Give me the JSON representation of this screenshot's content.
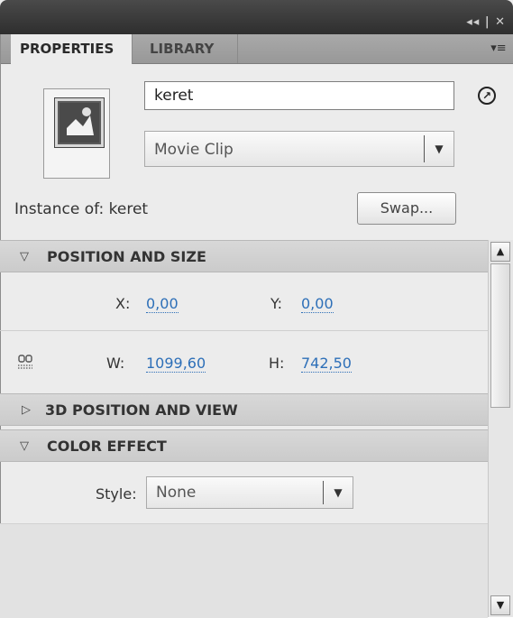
{
  "tabs": {
    "properties": "PROPERTIES",
    "library": "LIBRARY"
  },
  "window_controls": "◂◂ | ✕",
  "panel_menu_icon": "▾≡",
  "symbol": {
    "instance_name": "keret",
    "type": "Movie Clip",
    "instance_of_label": "Instance of:",
    "instance_of_value": "keret",
    "swap_label": "Swap..."
  },
  "sections": {
    "position_size": {
      "title": "POSITION AND SIZE",
      "x_label": "X:",
      "x_value": "0,00",
      "y_label": "Y:",
      "y_value": "0,00",
      "w_label": "W:",
      "w_value": "1099,60",
      "h_label": "H:",
      "h_value": "742,50"
    },
    "position_3d": {
      "title": "3D POSITION AND VIEW"
    },
    "color_effect": {
      "title": "COLOR EFFECT",
      "style_label": "Style:",
      "style_value": "None"
    }
  },
  "colors": {
    "value_link": "#2d6fb8",
    "title_bar": "#3a3a3a"
  }
}
